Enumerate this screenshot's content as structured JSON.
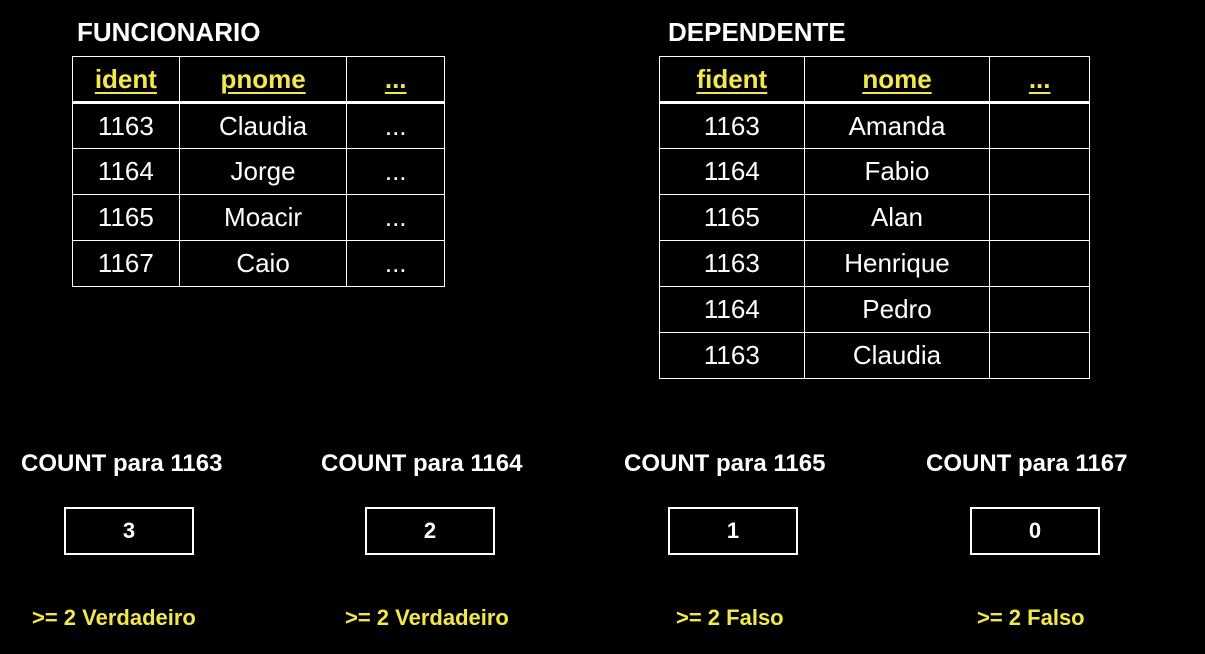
{
  "funcionario": {
    "title": "FUNCIONARIO",
    "headers": [
      "ident",
      "pnome",
      "..."
    ],
    "rows": [
      [
        "1163",
        "Claudia",
        "..."
      ],
      [
        "1164",
        "Jorge",
        "..."
      ],
      [
        "1165",
        "Moacir",
        "..."
      ],
      [
        "1167",
        "Caio",
        "..."
      ]
    ]
  },
  "dependente": {
    "title": "DEPENDENTE",
    "headers": [
      "fident",
      "nome",
      "..."
    ],
    "rows": [
      [
        "1163",
        "Amanda",
        ""
      ],
      [
        "1164",
        "Fabio",
        ""
      ],
      [
        "1165",
        "Alan",
        ""
      ],
      [
        "1163",
        "Henrique",
        ""
      ],
      [
        "1164",
        "Pedro",
        ""
      ],
      [
        "1163",
        "Claudia",
        ""
      ]
    ]
  },
  "counts": [
    {
      "label": "COUNT para 1163",
      "value": "3",
      "result": ">= 2 Verdadeiro"
    },
    {
      "label": "COUNT para 1164",
      "value": "2",
      "result": ">= 2 Verdadeiro"
    },
    {
      "label": "COUNT para 1165",
      "value": "1",
      "result": ">= 2 Falso"
    },
    {
      "label": "COUNT para 1167",
      "value": "0",
      "result": ">= 2 Falso"
    }
  ]
}
